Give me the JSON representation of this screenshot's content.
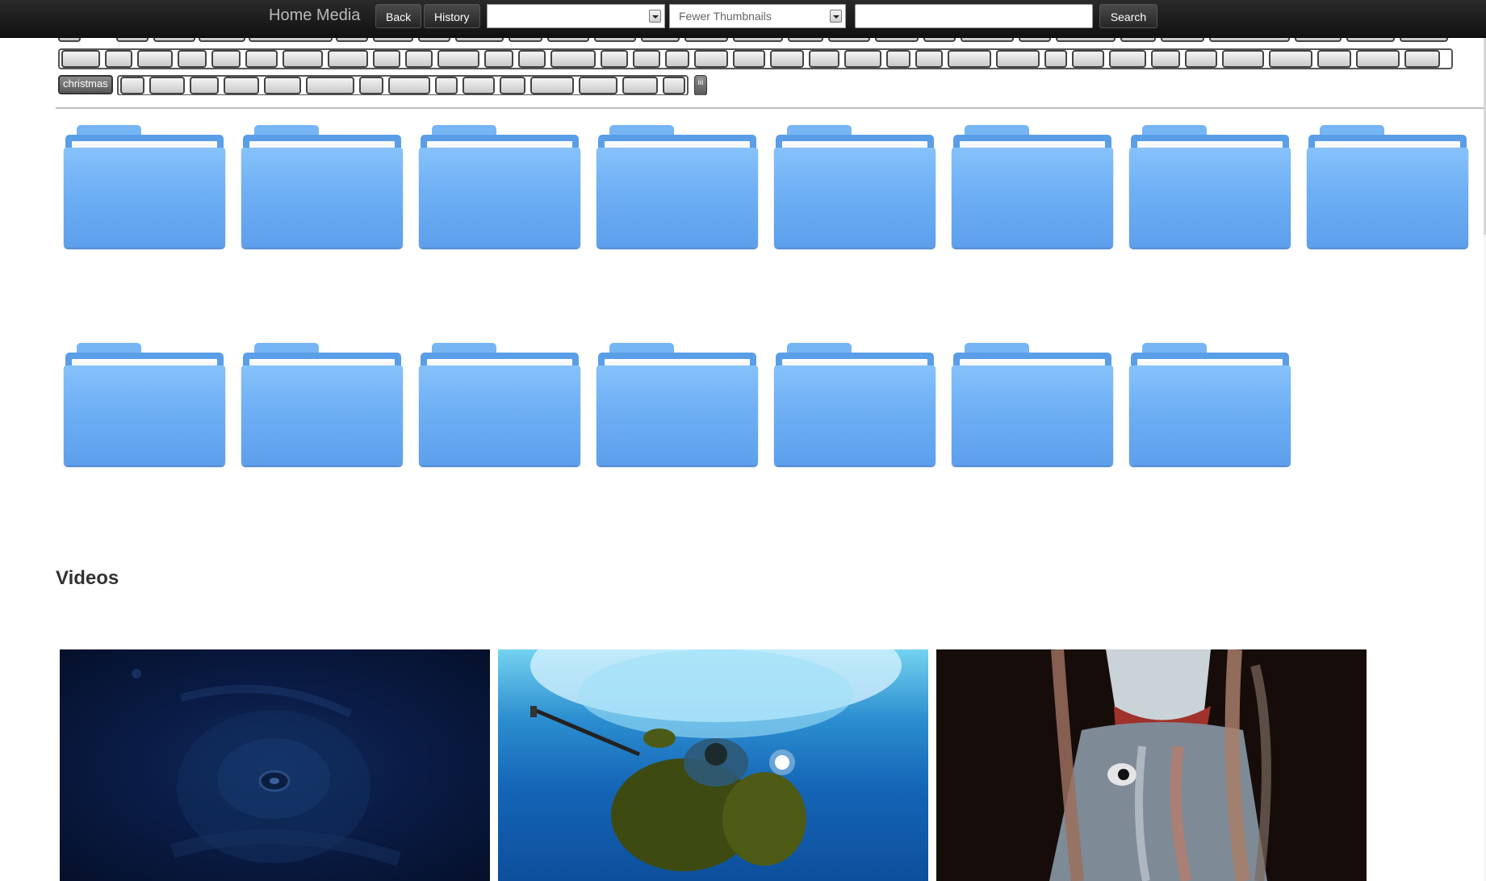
{
  "header": {
    "brand": "Home Media",
    "back_label": "Back",
    "history_label": "History",
    "folder_select_value": "",
    "thumbnail_select_value": "Fewer Thumbnails",
    "search_value": "",
    "search_label": "Search"
  },
  "tags": {
    "active_tag_label": "christmas",
    "roman_tag_label": "iii"
  },
  "videos": {
    "section_title": "Videos"
  },
  "colors": {
    "topbar": "#1a1a1a",
    "folder_blue": "#6eaff4",
    "tag_dark": "#6e6e6e"
  },
  "icons": [
    "folder-icon",
    "dropdown-arrow-icon"
  ]
}
